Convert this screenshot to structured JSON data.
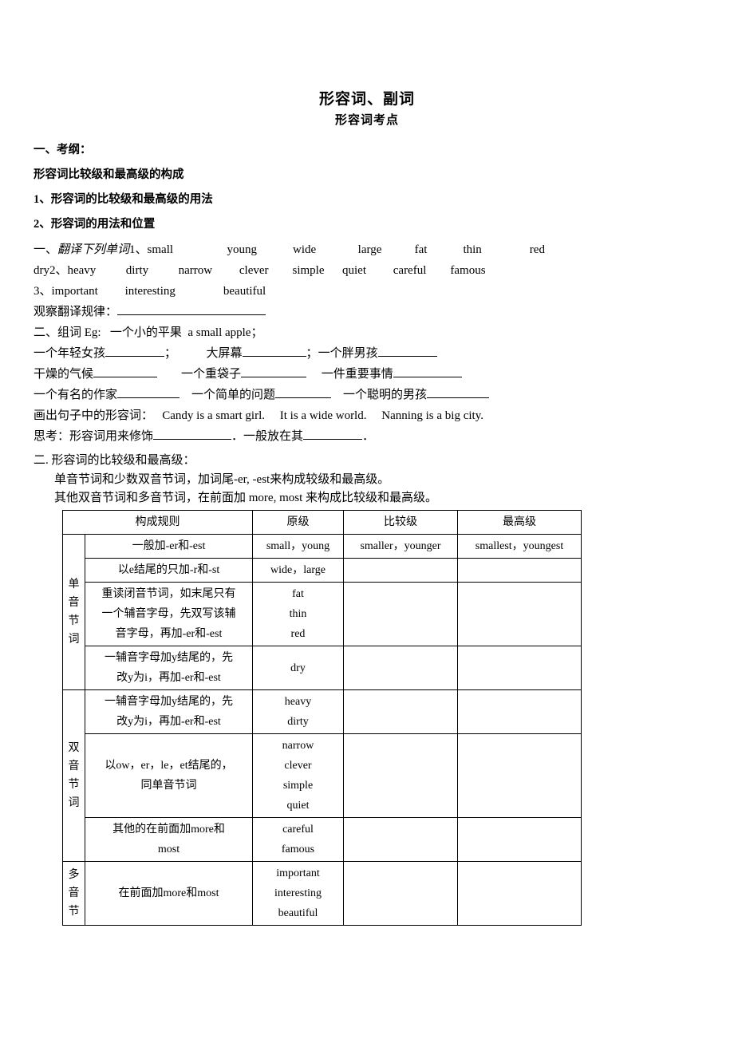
{
  "document": {
    "title": "形容词、副词",
    "subtitle": "形容词考点",
    "headings": {
      "outline": "一、考纲：",
      "formation": "形容词比较级和最高级的构成",
      "point1": "1、形容词的比较级和最高级的用法",
      "point2": "2、形容词的用法和位置"
    },
    "exercise1": {
      "label_prefix": "一、",
      "label_italic": "翻译下列单词",
      "line1": "1、small                  young            wide              large           fat            thin                red",
      "line2": "dry2、heavy          dirty          narrow         clever        simple      quiet         careful        famous",
      "line3": "3、important         interesting                beautiful",
      "rule_prompt": "观察翻译规律："
    },
    "exercise2": {
      "intro": "二、组词 Eg:   一个小的平果  a small apple；",
      "pairs_line1": [
        {
          "zh": "一个年轻女孩",
          "after": "；"
        },
        {
          "zh": "大屏幕",
          "after": "；"
        },
        {
          "zh": "一个胖男孩",
          "after": ""
        }
      ],
      "pairs_line2": [
        {
          "zh": "干燥的气候",
          "after": ""
        },
        {
          "zh": "一个重袋子",
          "after": ""
        },
        {
          "zh": "一件重要事情",
          "after": ""
        }
      ],
      "pairs_line3": [
        {
          "zh": "一个有名的作家",
          "after": ""
        },
        {
          "zh": "一个简单的问题",
          "after": ""
        },
        {
          "zh": "一个聪明的男孩",
          "after": ""
        }
      ],
      "underline_prompt": "画出句子中的形容词：",
      "sentences": [
        "Candy is a smart girl.",
        "It is a wide world.",
        "Nanning is a big city."
      ],
      "think_prefix": "思考：形容词用来修饰",
      "think_middle": "．一般放在其",
      "think_suffix": "．"
    },
    "section2": {
      "heading": "二. 形容词的比较级和最高级：",
      "rule_line1": "单音节词和少数双音节词，加词尾-er, -est来构成较级和最高级。",
      "rule_line2": "其他双音节词和多音节词，在前面加 more, most 来构成比较级和最高级。"
    },
    "table": {
      "headers": [
        "构成规则",
        "原级",
        "比较级",
        "最高级"
      ],
      "groups": [
        {
          "label": "单音节词",
          "rows": [
            {
              "rule": [
                "一般加-er和-est"
              ],
              "original": [
                "small，young"
              ],
              "comparative": [
                "smaller，younger"
              ],
              "superlative": [
                "smallest，youngest"
              ]
            },
            {
              "rule": [
                "以e结尾的只加-r和-st"
              ],
              "original": [
                "wide，large"
              ],
              "comparative": [],
              "superlative": []
            },
            {
              "rule": [
                "重读闭音节词，如末尾只有",
                "一个辅音字母，先双写该辅",
                "音字母，再加-er和-est"
              ],
              "original": [
                "fat",
                "thin",
                "red"
              ],
              "comparative": [],
              "superlative": []
            },
            {
              "rule": [
                "一辅音字母加y结尾的，先",
                "改y为i，再加-er和-est"
              ],
              "original": [
                "dry"
              ],
              "comparative": [],
              "superlative": []
            }
          ]
        },
        {
          "label": "双音节词",
          "rows": [
            {
              "rule": [
                "一辅音字母加y结尾的，先",
                "改y为i，再加-er和-est"
              ],
              "original": [
                "heavy",
                "dirty"
              ],
              "comparative": [],
              "superlative": []
            },
            {
              "rule": [
                "以ow，er，le，et结尾的，",
                "同单音节词"
              ],
              "original": [
                "narrow",
                "clever",
                "simple",
                "quiet"
              ],
              "comparative": [],
              "superlative": []
            },
            {
              "rule": [
                "其他的在前面加more和",
                "most"
              ],
              "original": [
                "careful",
                "famous"
              ],
              "comparative": [],
              "superlative": []
            }
          ]
        },
        {
          "label": "多音节",
          "rows": [
            {
              "rule": [
                "在前面加more和most"
              ],
              "original": [
                "important",
                "interesting",
                "beautiful"
              ],
              "comparative": [],
              "superlative": []
            }
          ]
        }
      ]
    }
  }
}
